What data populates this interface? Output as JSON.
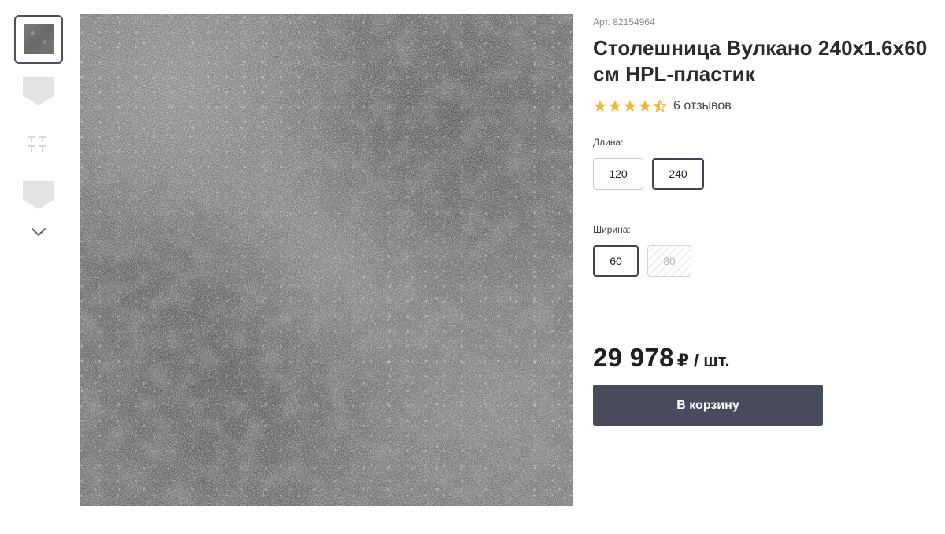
{
  "gallery": {
    "thumbnails": [
      {
        "name": "thumbnail-stone-texture",
        "active": true
      },
      {
        "name": "thumbnail-profile-edge",
        "active": false
      },
      {
        "name": "thumbnail-connectors",
        "active": false
      },
      {
        "name": "thumbnail-profile-edge-2",
        "active": false
      }
    ],
    "more_icon": "chevron-down-icon",
    "main_image": "stone-texture-gray"
  },
  "product": {
    "article": "Арт. 82154964",
    "title": "Столешница Вулкано 240x1.6x60 см HPL-пластик",
    "rating": 4.5,
    "rating_max": 5,
    "reviews": "6 отзывов",
    "star_color": "#f0b93a"
  },
  "options": {
    "length_label": "Длина:",
    "length_values": [
      "120",
      "240"
    ],
    "length_selected": "240",
    "width_label": "Ширина:",
    "width_values": [
      "60",
      "80"
    ],
    "width_selected": "60",
    "width_disabled": "80"
  },
  "price": {
    "value": "29 978",
    "currency": "₽",
    "unit": "/ шт."
  },
  "cart": {
    "label": "В корзину",
    "color": "#474b5c"
  }
}
